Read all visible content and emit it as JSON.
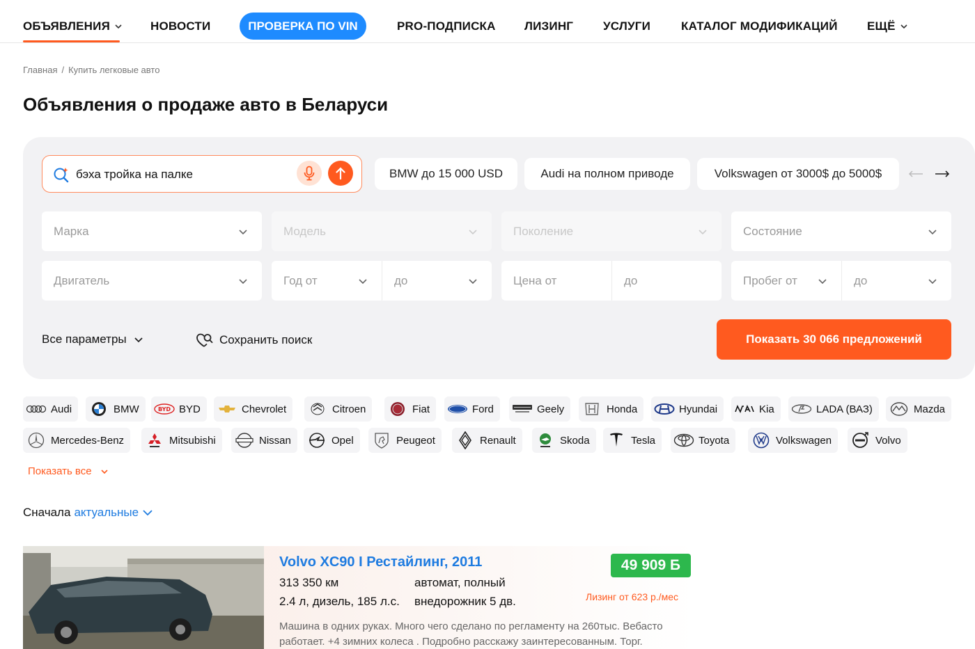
{
  "nav": {
    "ads": "ОБЪЯВЛЕНИЯ",
    "news": "НОВОСТИ",
    "vin": "ПРОВЕРКА ПО VIN",
    "pro": "PRO-ПОДПИСКА",
    "leasing": "ЛИЗИНГ",
    "services": "УСЛУГИ",
    "catalog": "КАТАЛОГ МОДИФИКАЦИЙ",
    "more": "ЕЩЁ",
    "accent": "#ff5a1f",
    "vin_color": "#1e8bff"
  },
  "breadcrumb": {
    "home": "Главная",
    "sep": "/",
    "current": "Купить легковые авто"
  },
  "page_title": "Объявления о продаже авто в Беларуси",
  "search": {
    "value": "бэха тройка на палке",
    "mic_icon": "microphone-icon",
    "go_icon": "arrow-up-icon"
  },
  "chips": [
    "BMW до 15 000 USD",
    "Audi на полном приводе",
    "Volkswagen от 3000$ до 5000$"
  ],
  "filters": {
    "brand": "Марка",
    "model": "Модель",
    "generation": "Поколение",
    "condition": "Состояние",
    "engine": "Двигатель",
    "year_from": "Год от",
    "year_to": "до",
    "price_from": "Цена от",
    "price_to": "до",
    "mileage_from": "Пробег от",
    "mileage_to": "до"
  },
  "actions": {
    "all_params": "Все параметры",
    "save_search": "Сохранить поиск",
    "show": "Показать 30 066 предложений"
  },
  "brands": [
    "Audi",
    "BMW",
    "BYD",
    "Chevrolet",
    "Citroen",
    "Fiat",
    "Ford",
    "Geely",
    "Honda",
    "Hyundai",
    "Kia",
    "LADA (ВАЗ)",
    "Mazda",
    "Mercedes-Benz",
    "Mitsubishi",
    "Nissan",
    "Opel",
    "Peugeot",
    "Renault",
    "Skoda",
    "Tesla",
    "Toyota",
    "Volkswagen",
    "Volvo"
  ],
  "show_all": "Показать все",
  "sort": {
    "label": "Сначала",
    "value": "актуальные"
  },
  "listing": {
    "title": "Volvo XC90 I Рестайлинг, 2011",
    "price": "49 909 Ƃ",
    "mileage": "313 350 км",
    "transmission": "автомат, полный",
    "engine": "2.4 л, дизель, 185 л.с.",
    "body": "внедорожник 5 дв.",
    "leasing": "Лизинг от 623 р./мес",
    "description": "Машина в одних руках. Много чего сделано по регламенту на 260тыс. Вебасто работает. +4 зимних колеса . Подробно расскажу заинтересованным. Торг.",
    "price_color": "#2db84d"
  }
}
